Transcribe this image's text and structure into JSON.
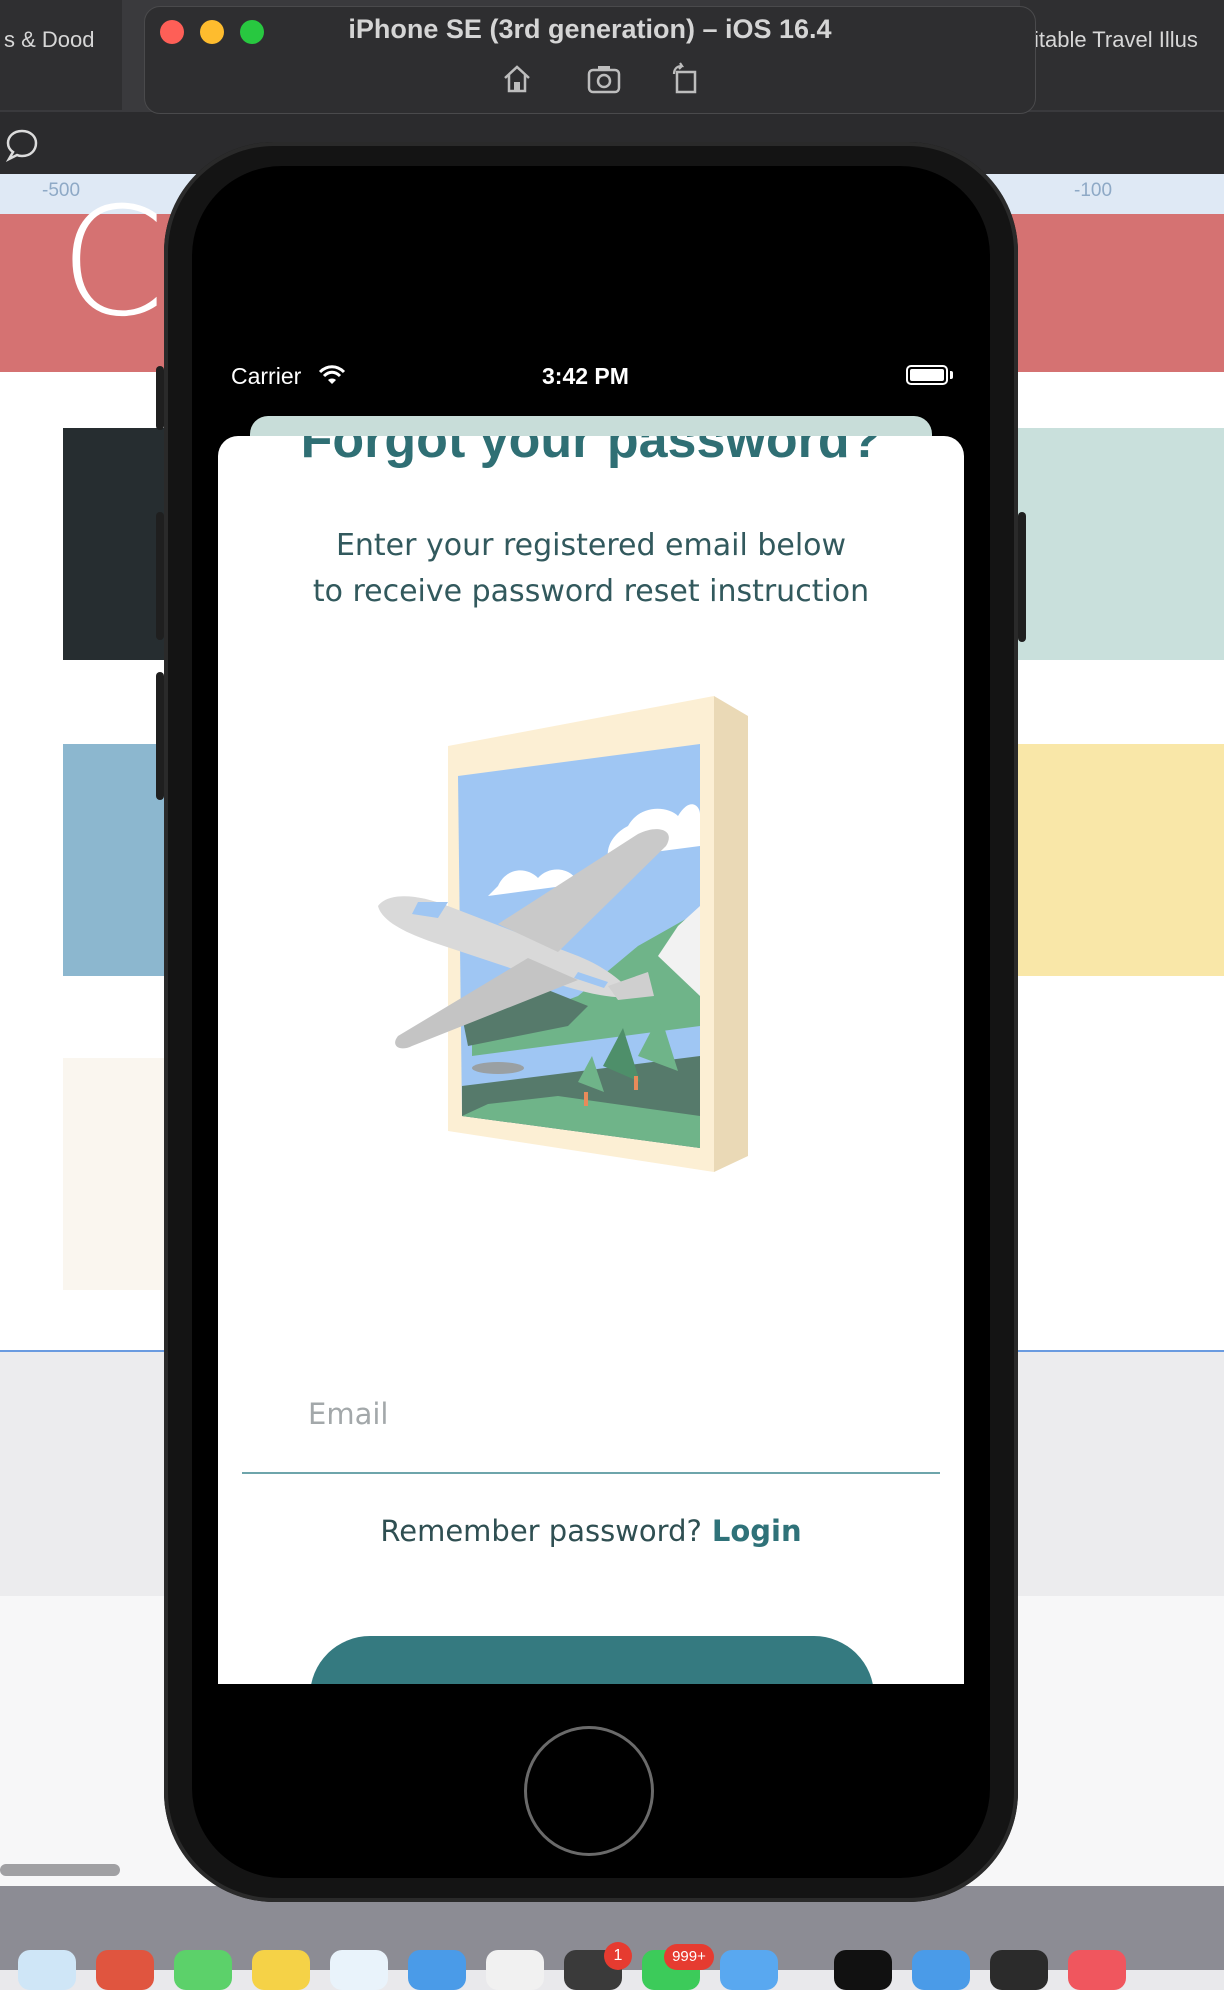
{
  "mac": {
    "left_tab": "s & Dood",
    "right_tab": "itable Travel Illus",
    "ruler": {
      "left_tick": "-500",
      "right_tick": "-100"
    },
    "canvas_letter": "C",
    "dock_badges": [
      "1",
      "999+"
    ]
  },
  "simulator": {
    "title": "iPhone SE (3rd generation) – iOS 16.4",
    "icons": [
      "home-icon",
      "screenshot-icon",
      "rotate-icon"
    ]
  },
  "status_bar": {
    "carrier": "Carrier",
    "time": "3:42 PM"
  },
  "screen": {
    "title": "Forgot your password?",
    "subtitle_line1": "Enter your registered email below",
    "subtitle_line2": "to receive password reset instruction",
    "email_placeholder": "Email",
    "remember_text": "Remember password?",
    "login_link": "Login"
  },
  "colors": {
    "accent": "#357a80",
    "title": "#2f6f74",
    "canvas_red": "#d57272"
  }
}
